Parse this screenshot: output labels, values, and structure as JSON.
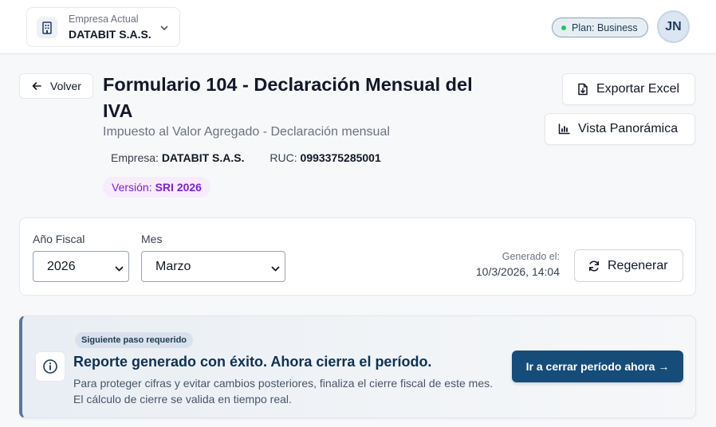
{
  "topbar": {
    "company_caption": "Empresa Actual",
    "company_name": "DATABIT S.A.S.",
    "plan_label": "Plan: Business",
    "avatar_initials": "JN"
  },
  "header": {
    "back_label": "Volver",
    "title": "Formulario 104 - Declaración Mensual del IVA",
    "subtitle": "Impuesto al Valor Agregado - Declaración mensual",
    "company_label": "Empresa:",
    "company_value": "DATABIT S.A.S.",
    "ruc_label": "RUC:",
    "ruc_value": "0993375285001",
    "version_label": "Versión:",
    "version_value": "SRI 2026",
    "export_label": "Exportar Excel",
    "panorama_label": "Vista Panorámica"
  },
  "filters": {
    "year_label": "Año Fiscal",
    "year_value": "2026",
    "month_label": "Mes",
    "month_value": "Marzo",
    "generated_label": "Generado el:",
    "generated_value": "10/3/2026, 14:04",
    "regenerate_label": "Regenerar"
  },
  "notice": {
    "badge": "Siguiente paso requerido",
    "title": "Reporte generado con éxito. Ahora cierra el período.",
    "text": "Para proteger cifras y evitar cambios posteriores, finaliza el cierre fiscal de este mes. El cálculo de cierre se valida en tiempo real.",
    "cta_label": "Ir a cerrar período ahora →"
  },
  "colors": {
    "primary": "#164c78",
    "version_purple": "#7e22ce",
    "plan_dot": "#22c55e"
  }
}
